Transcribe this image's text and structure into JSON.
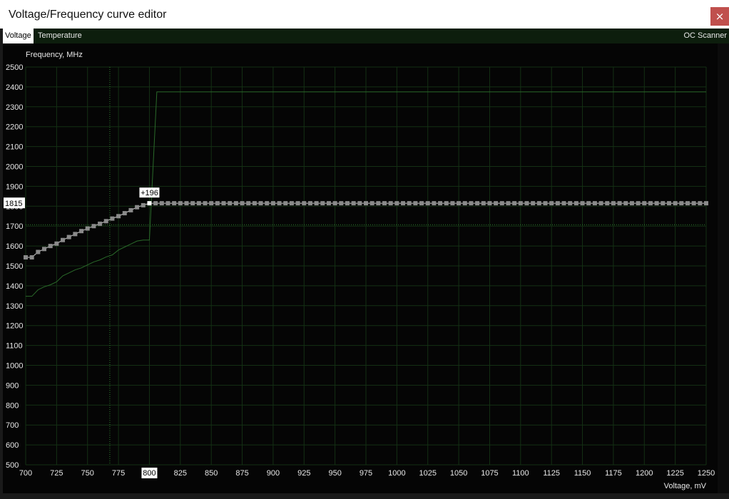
{
  "window": {
    "title": "Voltage/Frequency curve editor",
    "close_glyph": "×"
  },
  "tabs": [
    {
      "label": "Voltage",
      "active": true
    },
    {
      "label": "Temperature",
      "active": false
    }
  ],
  "oc_scanner_label": "OC Scanner",
  "colors": {
    "grid": "#143014",
    "curve": "#2a6a2a",
    "points": "#8a8a8a",
    "selected_point": "#ffffff",
    "dotted_ref": "#2f7f2f"
  },
  "chart_data": {
    "type": "line",
    "xlabel": "Voltage, mV",
    "ylabel": "Frequency, MHz",
    "xlim": [
      700,
      1250
    ],
    "ylim": [
      500,
      2500
    ],
    "x_ticks": [
      700,
      725,
      750,
      775,
      800,
      825,
      850,
      875,
      900,
      925,
      950,
      975,
      1000,
      1025,
      1050,
      1075,
      1100,
      1125,
      1150,
      1175,
      1200,
      1225,
      1250
    ],
    "y_ticks": [
      500,
      600,
      700,
      800,
      900,
      1000,
      1100,
      1200,
      1300,
      1400,
      1500,
      1600,
      1700,
      1800,
      1900,
      2000,
      2100,
      2200,
      2300,
      2400,
      2500
    ],
    "highlighted_x_tick": 800,
    "highlighted_y_value": "1815",
    "selected_point": {
      "x": 800,
      "y": 1815,
      "offset_label": "+196"
    },
    "reference_lines": {
      "vertical_x": 768,
      "horizontal_y": 1707
    },
    "series": [
      {
        "role": "default_curve",
        "x": [
          700,
          705,
          710,
          715,
          720,
          725,
          730,
          735,
          740,
          745,
          750,
          755,
          760,
          765,
          770,
          775,
          780,
          785,
          790,
          795,
          800,
          806,
          1250
        ],
        "y": [
          1347,
          1347,
          1380,
          1395,
          1405,
          1420,
          1450,
          1465,
          1480,
          1490,
          1505,
          1520,
          1530,
          1545,
          1555,
          1580,
          1595,
          1610,
          1625,
          1630,
          1630,
          2375,
          2375
        ]
      },
      {
        "role": "adjusted_curve",
        "x": [
          700,
          705,
          710,
          715,
          720,
          725,
          730,
          735,
          740,
          745,
          750,
          755,
          760,
          765,
          770,
          775,
          780,
          785,
          790,
          795,
          800,
          805,
          810,
          815,
          820,
          825,
          830,
          835,
          840,
          845,
          850,
          855,
          860,
          865,
          870,
          875,
          880,
          885,
          890,
          895,
          900,
          905,
          910,
          915,
          920,
          925,
          930,
          935,
          940,
          945,
          950,
          955,
          960,
          965,
          970,
          975,
          980,
          985,
          990,
          995,
          1000,
          1005,
          1010,
          1015,
          1020,
          1025,
          1030,
          1035,
          1040,
          1045,
          1050,
          1055,
          1060,
          1065,
          1070,
          1075,
          1080,
          1085,
          1090,
          1095,
          1100,
          1105,
          1110,
          1115,
          1120,
          1125,
          1130,
          1135,
          1140,
          1145,
          1150,
          1155,
          1160,
          1165,
          1170,
          1175,
          1180,
          1185,
          1190,
          1195,
          1200,
          1205,
          1210,
          1215,
          1220,
          1225,
          1230,
          1235,
          1240,
          1245,
          1250
        ],
        "y": [
          1543,
          1543,
          1570,
          1585,
          1600,
          1612,
          1630,
          1645,
          1660,
          1675,
          1688,
          1700,
          1712,
          1725,
          1738,
          1750,
          1765,
          1780,
          1795,
          1805,
          1815,
          1815,
          1815,
          1815,
          1815,
          1815,
          1815,
          1815,
          1815,
          1815,
          1815,
          1815,
          1815,
          1815,
          1815,
          1815,
          1815,
          1815,
          1815,
          1815,
          1815,
          1815,
          1815,
          1815,
          1815,
          1815,
          1815,
          1815,
          1815,
          1815,
          1815,
          1815,
          1815,
          1815,
          1815,
          1815,
          1815,
          1815,
          1815,
          1815,
          1815,
          1815,
          1815,
          1815,
          1815,
          1815,
          1815,
          1815,
          1815,
          1815,
          1815,
          1815,
          1815,
          1815,
          1815,
          1815,
          1815,
          1815,
          1815,
          1815,
          1815,
          1815,
          1815,
          1815,
          1815,
          1815,
          1815,
          1815,
          1815,
          1815,
          1815,
          1815,
          1815,
          1815,
          1815,
          1815,
          1815,
          1815,
          1815,
          1815,
          1815,
          1815,
          1815,
          1815,
          1815,
          1815,
          1815,
          1815,
          1815,
          1815,
          1815
        ]
      }
    ]
  }
}
